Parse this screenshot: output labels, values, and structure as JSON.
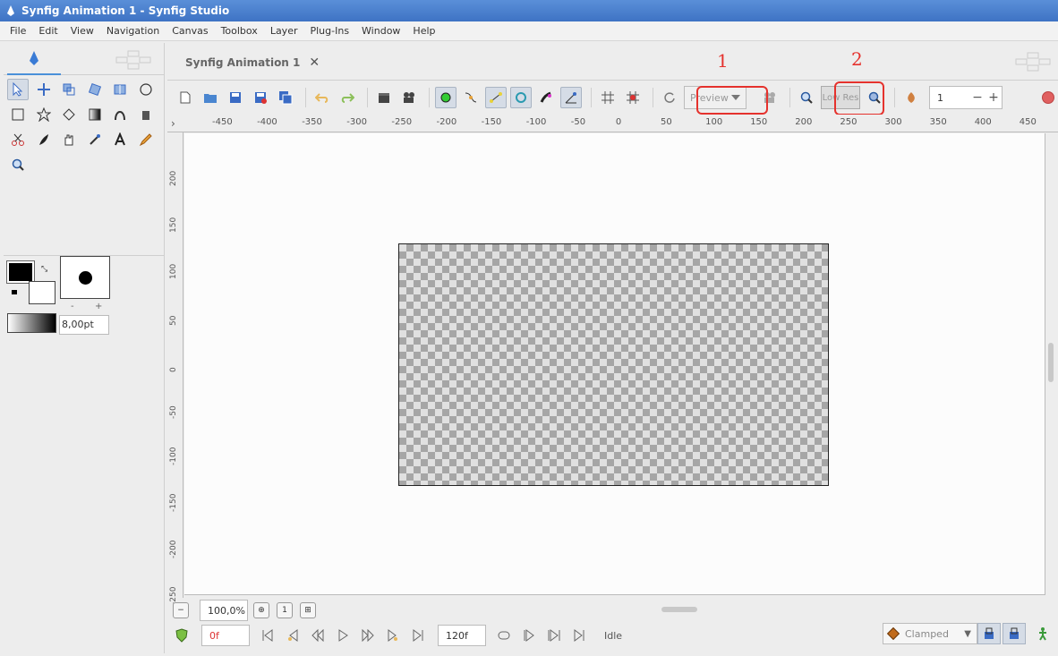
{
  "window": {
    "title": "Synfig Animation 1 - Synfig Studio"
  },
  "menu": [
    "File",
    "Edit",
    "View",
    "Navigation",
    "Canvas",
    "Toolbox",
    "Layer",
    "Plug-Ins",
    "Window",
    "Help"
  ],
  "document_tab": {
    "label": "Synfig Animation 1",
    "close_glyph": "✕"
  },
  "toolbar": {
    "preview_combo": "Preview",
    "low_res_label": "Low Res",
    "onion_spin_value": "1",
    "minus": "−",
    "plus": "+"
  },
  "annotations": {
    "one": "1",
    "two": "2"
  },
  "brush": {
    "width": "8,00pt",
    "minus": "-",
    "plus": "+"
  },
  "ruler_h_labels": [
    "-450",
    "-400",
    "-350",
    "-300",
    "-250",
    "-200",
    "-150",
    "-100",
    "-50",
    "0",
    "50",
    "100",
    "150",
    "200",
    "250",
    "300",
    "350",
    "400",
    "450"
  ],
  "ruler_v_labels": [
    "200",
    "150",
    "100",
    "50",
    "0",
    "-50",
    "-100",
    "-150",
    "-200",
    "-250"
  ],
  "zoom": {
    "value": "100,0%"
  },
  "time": {
    "current": "0f",
    "end": "120f",
    "status": "Idle"
  },
  "interpolation": {
    "value": "Clamped"
  },
  "colors": {
    "annotation": "#e5322d",
    "accent": "#4a90d9"
  }
}
